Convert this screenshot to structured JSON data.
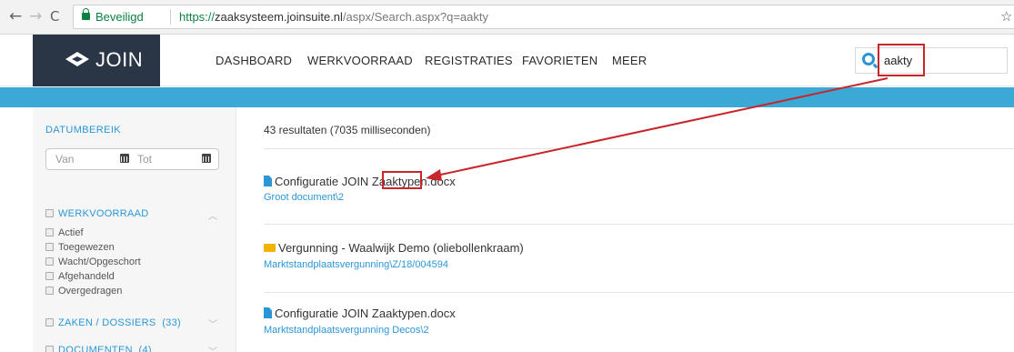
{
  "browser": {
    "back": "←",
    "forward": "→",
    "reload": "C",
    "secure_label": "Beveiligd",
    "url_proto": "https://",
    "url_host": "zaaksysteem.joinsuite.nl",
    "url_path": "/aspx/Search.aspx?q=aakty",
    "bookmark": "☆"
  },
  "app": {
    "logo_text": "JOIN",
    "menu": [
      "DASHBOARD",
      "WERKVOORRAAD",
      "REGISTRATIES",
      "FAVORIETEN",
      "MEER"
    ],
    "search_value": "aakty"
  },
  "sidebar": {
    "date_label": "DATUMBEREIK",
    "date_from_placeholder": "Van",
    "date_to_placeholder": "Tot",
    "werkvoorraad_label": "WERKVOORRAAD",
    "werkvoorraad_options": [
      "Actief",
      "Toegewezen",
      "Wacht/Opgeschort",
      "Afgehandeld",
      "Overgedragen"
    ],
    "zaken_label": "ZAKEN / DOSSIERS  (33)",
    "documenten_label": "DOCUMENTEN  (4)"
  },
  "results": {
    "count_text": "43 resultaten (7035 milliseconden)",
    "items": [
      {
        "type": "document",
        "title": "Configuratie JOIN Zaaktypen.docx",
        "path": "Groot document\\2"
      },
      {
        "type": "folder",
        "title": "Vergunning - Waalwijk Demo (oliebollenkraam)",
        "path": "Marktstandplaatsvergunning\\Z/18/004594"
      },
      {
        "type": "document",
        "title": "Configuratie JOIN Zaaktypen.docx",
        "path": "Marktstandplaatsvergunning Decos\\2"
      }
    ]
  },
  "colors": {
    "accent": "#2a96d6",
    "header_dark": "#2a3546",
    "banner": "#3aa9d6",
    "annotation": "#c8262b"
  }
}
